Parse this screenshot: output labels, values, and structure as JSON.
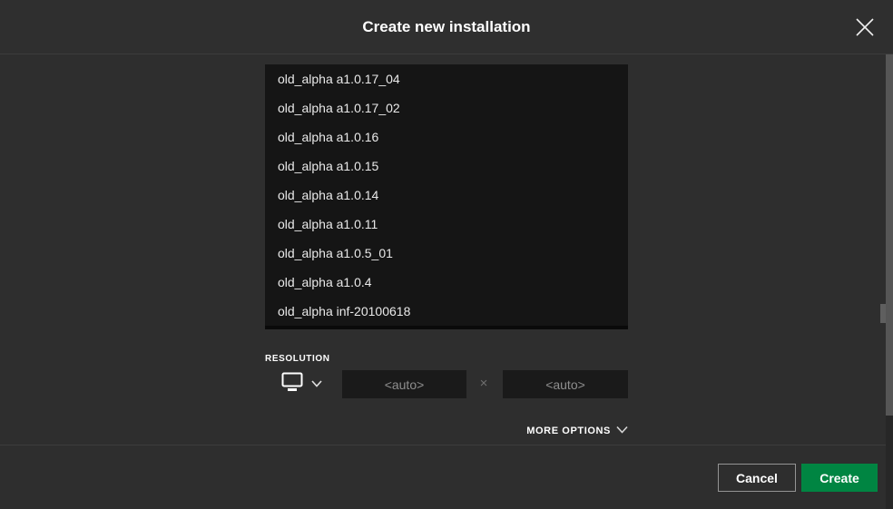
{
  "header": {
    "title": "Create new installation",
    "close_icon": "x-cross"
  },
  "version_list": {
    "items": [
      "old_alpha a1.0.17_04",
      "old_alpha a1.0.17_02",
      "old_alpha a1.0.16",
      "old_alpha a1.0.15",
      "old_alpha a1.0.14",
      "old_alpha a1.0.11",
      "old_alpha a1.0.5_01",
      "old_alpha a1.0.4",
      "old_alpha inf-20100618"
    ]
  },
  "resolution": {
    "label": "RESOLUTION",
    "monitor_icon": "monitor-display",
    "chevron_icon": "chevron-down",
    "width_value": "",
    "width_placeholder": "<auto>",
    "separator": "×",
    "height_value": "",
    "height_placeholder": "<auto>"
  },
  "more_options": {
    "label": "MORE OPTIONS",
    "chevron_icon": "chevron-down"
  },
  "footer": {
    "cancel_label": "Cancel",
    "create_label": "Create"
  },
  "colors": {
    "dialog_bg": "#2e2e2e",
    "list_bg": "#151515",
    "input_bg": "#1a1a1a",
    "placeholder_text": "#8e8e8e",
    "accent_green": "#008542",
    "text_white": "#ffffff"
  }
}
